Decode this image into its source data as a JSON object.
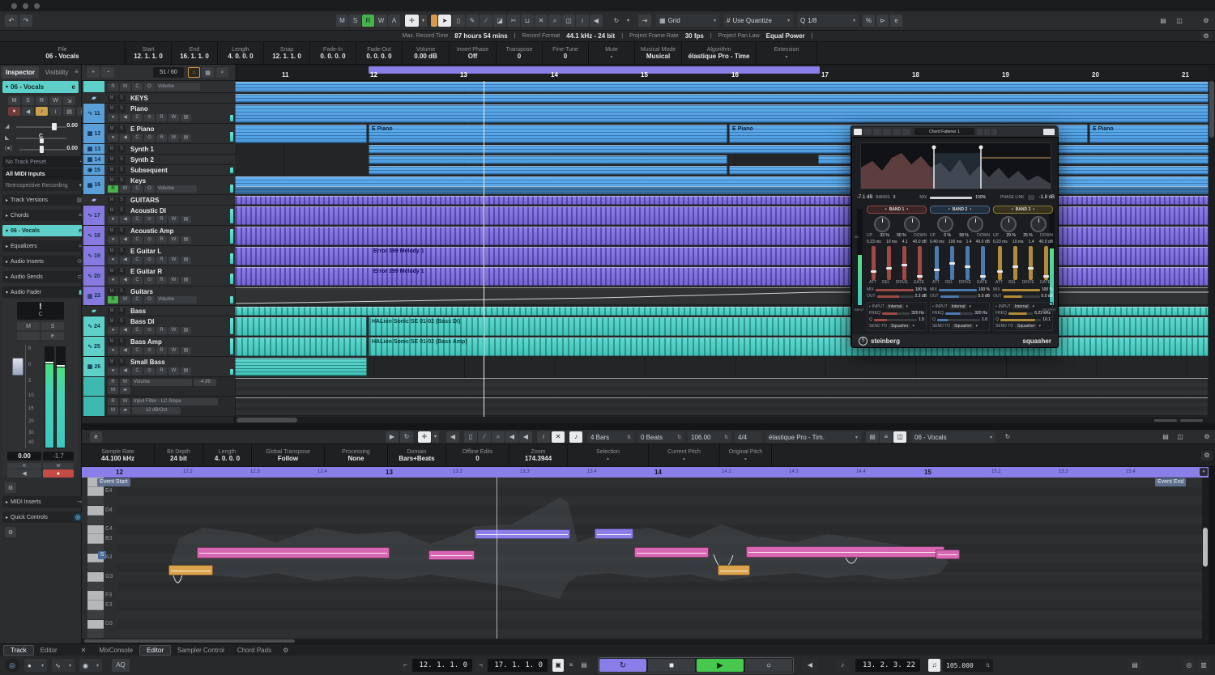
{
  "colors": {
    "accent_teal": "#5fd0c9",
    "accent_blue": "#55a7e8",
    "accent_purple": "#8177dd",
    "accent_pink": "#d767b2",
    "accent_orange": "#dba34e",
    "play_green": "#46c94e",
    "loop_purple": "#8a80e8",
    "record_red": "#c44c44"
  },
  "icons": {
    "undo": "↶",
    "redo": "↷",
    "dropdown": "▾",
    "stepper": "⇅",
    "autoscroll": "✛",
    "select": "➤",
    "range": "▯",
    "pencil": "✎",
    "lineTool": "∕",
    "eraser": "◪",
    "scissors": "✂",
    "glue": "⊔",
    "muteTool": "✕",
    "magnify": "⌕",
    "comp": "◫",
    "warp": "≀",
    "scrub": "◀",
    "feedback": "↻",
    "snap": "⇥",
    "hash": "#",
    "q": "Q",
    "iterative": "%",
    "panel": "⊳",
    "refresh": "e",
    "windowA": "▤",
    "windowB": "◫",
    "gear": "⚙",
    "menu": "≡",
    "chevR": "▸",
    "chevD": "▾",
    "folder": "▰",
    "wave": "∿",
    "keysIcon": "▦",
    "synth": "◉",
    "monitor": "◀",
    "recordDot": "●",
    "play": "▶",
    "stop": "■",
    "loop": "↻",
    "circle": "○",
    "note": "♪",
    "home": "⌂",
    "grid": "▦",
    "plus": "+",
    "preset": "◔",
    "close": "✕",
    "lflag": "⌐",
    "rflag": "¬",
    "speaker": "◀",
    "eq": "≈",
    "insert": "⊙",
    "send": "⊂",
    "fader": "▮",
    "midiplug": "⊸",
    "qc": "◎",
    "lr": "⇲",
    "list": "≡",
    "lockIcon": "▣",
    "kbd": "▤",
    "meterIcon": "▥",
    "metro": "♫",
    "bang": "!",
    "dot": "•"
  },
  "toolbar": {
    "automation": [
      "M",
      "S",
      "R",
      "W",
      "A"
    ],
    "grid": "Grid",
    "use_quantize": "Use Quantize",
    "quantize_value": "1/8"
  },
  "status_line": {
    "items": [
      {
        "label": "Max. Record Time",
        "value": "87 hours 54 mins"
      },
      {
        "label": "Record Format",
        "value": "44.1 kHz - 24 bit"
      },
      {
        "label": "Project Frame Rate",
        "value": "30 fps"
      },
      {
        "label": "Project Pan Law",
        "value": "Equal Power"
      }
    ]
  },
  "info_line": {
    "fields": [
      {
        "label": "File",
        "value": "06 - Vocals"
      },
      {
        "label": "Start",
        "value": "12. 1. 1.  0"
      },
      {
        "label": "End",
        "value": "16. 1. 1.  0"
      },
      {
        "label": "Length",
        "value": "4. 0. 0.  0"
      },
      {
        "label": "Snap",
        "value": "12. 1. 1.  0"
      },
      {
        "label": "Fade-In",
        "value": "0. 0. 0.  0"
      },
      {
        "label": "Fade-Out",
        "value": "0. 0. 0.  0"
      },
      {
        "label": "Volume",
        "value": "0.00 dB"
      },
      {
        "label": "Invert Phase",
        "value": "Off"
      },
      {
        "label": "Transpose",
        "value": "0"
      },
      {
        "label": "Fine-Tune",
        "value": "0"
      },
      {
        "label": "Mute",
        "value": "-"
      },
      {
        "label": "Musical Mode",
        "value": "Musical"
      },
      {
        "label": "Algorithm",
        "value": "élastique Pro - Time"
      },
      {
        "label": "Extension",
        "value": "-"
      }
    ]
  },
  "inspector": {
    "tabs": [
      "Inspector",
      "Visibility"
    ],
    "track_name": "06 - Vocals",
    "track_buttons": [
      "M",
      "S",
      "R",
      "W"
    ],
    "volume": "0.00",
    "pan": "C",
    "delay": "0.00",
    "preset": "No Track Preset",
    "input": "All MIDI Inputs",
    "retro": "Retrospective Recording",
    "sections": [
      {
        "label": "Track Versions"
      },
      {
        "label": "Chords"
      },
      {
        "label": "06 - Vocals"
      },
      {
        "label": "Equalizers"
      },
      {
        "label": "Audio Inserts"
      },
      {
        "label": "Audio Sends"
      },
      {
        "label": "Audio Fader"
      }
    ],
    "fader": {
      "display": "!",
      "pan_display": "C",
      "m": "M",
      "s": "S",
      "e": "e",
      "scale": [
        "6",
        "0",
        "5",
        "10",
        "15",
        "20",
        "30",
        "40"
      ],
      "value": "0.00",
      "peak": "-1.7",
      "r": "R",
      "w": "W"
    },
    "bottom_sections": [
      {
        "label": "MIDI Inserts"
      },
      {
        "label": "Quick Controls"
      }
    ]
  },
  "track_list": {
    "counter": "51 / 60",
    "controls": {
      "r": "R",
      "w": "W",
      "c": "C",
      "o": "O",
      "volume": "Volume",
      "m": "M",
      "s": "S"
    },
    "tracks": [
      {
        "num": "",
        "name": "",
        "type": "controls"
      },
      {
        "num": "",
        "name": "KEYS",
        "type": "folder"
      },
      {
        "num": "11",
        "name": "Piano",
        "type": "audio"
      },
      {
        "num": "12",
        "name": "E Piano",
        "type": "audio"
      },
      {
        "num": "13",
        "name": "Synth 1",
        "type": "slim"
      },
      {
        "num": "14",
        "name": "Synth 2",
        "type": "slim"
      },
      {
        "num": "15",
        "name": "Subsequent",
        "type": "slim"
      },
      {
        "num": "16",
        "name": "Keys",
        "type": "autotrack"
      },
      {
        "num": "",
        "name": "GUITARS",
        "type": "folder"
      },
      {
        "num": "17",
        "name": "Acoustic DI",
        "type": "audio"
      },
      {
        "num": "18",
        "name": "Acoustic Amp",
        "type": "audio"
      },
      {
        "num": "19",
        "name": "E Guitar L",
        "type": "audio"
      },
      {
        "num": "20",
        "name": "E Guitar R",
        "type": "audio"
      },
      {
        "num": "22",
        "name": "Guitars",
        "type": "autotrack"
      },
      {
        "num": "",
        "name": "Bass",
        "type": "folder"
      },
      {
        "num": "24",
        "name": "Bass DI",
        "type": "audio"
      },
      {
        "num": "25",
        "name": "Bass Amp",
        "type": "audio"
      },
      {
        "num": "26",
        "name": "Small Bass",
        "type": "audio"
      }
    ],
    "lanes": [
      {
        "param": "Volume",
        "value": "-4.99"
      },
      {
        "param": "Input Filter - LC-Slope",
        "value": "12 dB/Oct"
      }
    ]
  },
  "ruler": {
    "bars": [
      "11",
      "12",
      "13",
      "14",
      "15",
      "16",
      "17",
      "18",
      "19",
      "20",
      "21"
    ]
  },
  "arrange": {
    "labels": {
      "e_piano": "E Piano",
      "error_melody": "Error 399 Melody 1",
      "halion_di": "HALion Sonic SE 01-02 (Bass DI)",
      "halion_amp": "HALion Sonic SE 01-02 (Bass Amp)"
    }
  },
  "plugin": {
    "preset": "Chord Fattener 1",
    "left_db": "-7.1 dB",
    "right_db": "-1.8 dB",
    "bands_label": "BANDS",
    "bands_value": "3",
    "mix_label": "MIX",
    "mix_value": "100%",
    "phase_label": "PHASE LINK",
    "input_label": "INPUT",
    "output_label": "OUTPUT",
    "up_label": "UP",
    "down_label": "DOWN",
    "att_label": "ATT",
    "rel_label": "REL",
    "drive_label": "DRIVE",
    "gate_label": "GATE",
    "out_label": "OUT",
    "mixrow_label": "MIX",
    "freq_label": "FREQ",
    "q_label": "Q",
    "send_label": "SEND TO",
    "internal": "Internal",
    "send_target": "Squasher",
    "sc_label": "SC",
    "brand": "steinberg",
    "name": "squasher",
    "bands": [
      {
        "name": "BAND 1",
        "up": "33 %",
        "down": "50 %",
        "att": "0.23 ms",
        "rel": "10 ms",
        "drive": "4.1",
        "gate": "40.0 dB",
        "mix": "100 %",
        "out": "2.2 dB",
        "freq": "320 Hz",
        "q": "1.5"
      },
      {
        "name": "BAND 2",
        "up": "0 %",
        "down": "58 %",
        "att": "0.40 ms",
        "rel": "100 ms",
        "drive": "1.4",
        "gate": "40.0 dB",
        "mix": "100 %",
        "out": "0.0 dB",
        "freq": "320 Hz",
        "q": "1.0"
      },
      {
        "name": "BAND 3",
        "up": "29 %",
        "down": "25 %",
        "att": "0.23 ms",
        "rel": "10 ms",
        "drive": "1.4",
        "gate": "40.0 dB",
        "mix": "100 %",
        "out": "0.0 dB",
        "freq": "6.22 kHz",
        "q": "10.1"
      }
    ]
  },
  "lower_zone": {
    "toolbar": {
      "bars_value": "4 Bars",
      "beats_value": "0 Beats",
      "tempo": "106.00",
      "timesig": "4/4",
      "algorithm": "élastique Pro - Tim.",
      "track": "06 - Vocals"
    },
    "info": {
      "fields": [
        {
          "label": "Sample Rate",
          "value": "44.100 kHz"
        },
        {
          "label": "Bit Depth",
          "value": "24 bit"
        },
        {
          "label": "Length",
          "value": "4. 0. 0. 0"
        },
        {
          "label": "Global Transpose",
          "value": "Follow"
        },
        {
          "label": "Processing",
          "value": "None"
        },
        {
          "label": "Domain",
          "value": "Bars+Beats"
        },
        {
          "label": "Offline Edits",
          "value": "0"
        },
        {
          "label": "Zoom",
          "value": "174.3944"
        },
        {
          "label": "Selection",
          "value": "-"
        },
        {
          "label": "Current Pitch",
          "value": "-"
        },
        {
          "label": "Original Pitch",
          "value": "-"
        }
      ]
    },
    "ruler": {
      "bars": [
        "12",
        "13",
        "14",
        "15"
      ],
      "subs": [
        "12.2",
        "12.3",
        "12.4",
        "13.2",
        "13.3",
        "13.4",
        "14.2",
        "14.3",
        "14.4",
        "15.2",
        "15.3",
        "15.4"
      ],
      "event_start": "Event Start",
      "event_end": "Event End"
    },
    "keys": [
      "E4",
      "D4",
      "C4",
      "B3",
      "A3",
      "G3",
      "F3",
      "E3",
      "D3"
    ],
    "scale_badge": "S"
  },
  "bottom_tabs": {
    "left": [
      "Track",
      "Editor"
    ],
    "tabs": [
      "MixConsole",
      "Editor",
      "Sampler Control",
      "Chord Pads"
    ]
  },
  "transport": {
    "aq": "AQ",
    "left_locator": "12. 1. 1.  0",
    "right_locator": "17. 1. 1.  0",
    "position": "13. 2. 3. 22",
    "tempo": "105.000"
  }
}
